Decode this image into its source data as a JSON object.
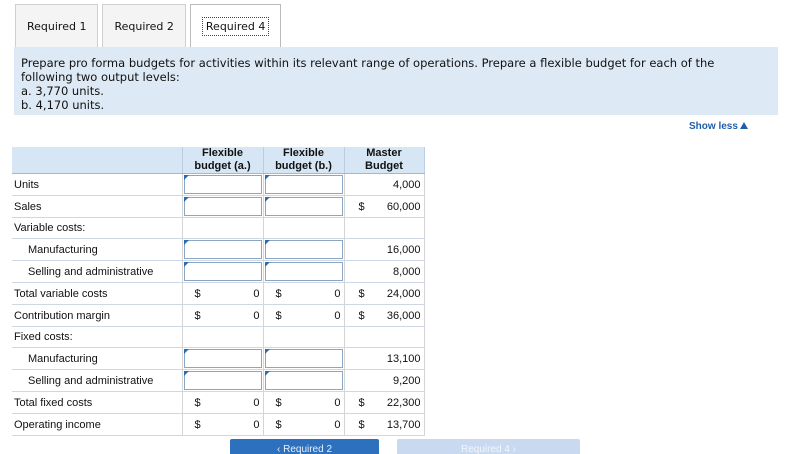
{
  "tabs": [
    {
      "label": "Required 1"
    },
    {
      "label": "Required 2"
    },
    {
      "label": "Required 4"
    }
  ],
  "instructions": {
    "line1": "Prepare pro forma budgets for activities within its relevant range of operations. Prepare a flexible budget for each of the",
    "line2": "following two output levels:",
    "line3": "a. 3,770 units.",
    "line4": "b. 4,170 units."
  },
  "show_less": "Show less",
  "table": {
    "headers": {
      "flex_a_1": "Flexible",
      "flex_a_2": "budget (a.)",
      "flex_b_1": "Flexible",
      "flex_b_2": "budget (b.)",
      "master_1": "Master",
      "master_2": "Budget"
    },
    "rows": {
      "units": {
        "label": "Units",
        "master": "4,000"
      },
      "sales": {
        "label": "Sales",
        "cur": "$",
        "master": "60,000"
      },
      "variable_costs": {
        "label": "Variable costs:"
      },
      "var_mfg": {
        "label": "Manufacturing",
        "master": "16,000"
      },
      "var_sa": {
        "label": "Selling and administrative",
        "master": "8,000"
      },
      "total_var": {
        "label": "Total variable costs",
        "cur": "$",
        "a": "0",
        "b": "0",
        "master": "24,000"
      },
      "contrib": {
        "label": "Contribution margin",
        "cur": "$",
        "a": "0",
        "b": "0",
        "master": "36,000"
      },
      "fixed_costs": {
        "label": "Fixed costs:"
      },
      "fix_mfg": {
        "label": "Manufacturing",
        "master": "13,100"
      },
      "fix_sa": {
        "label": "Selling and administrative",
        "master": "9,200"
      },
      "total_fixed": {
        "label": "Total fixed costs",
        "cur": "$",
        "a": "0",
        "b": "0",
        "master": "22,300"
      },
      "op_income": {
        "label": "Operating income",
        "cur": "$",
        "a": "0",
        "b": "0",
        "master": "13,700"
      }
    }
  },
  "nav": {
    "prev": "‹  Required 2",
    "next": "Required 4  ›"
  }
}
